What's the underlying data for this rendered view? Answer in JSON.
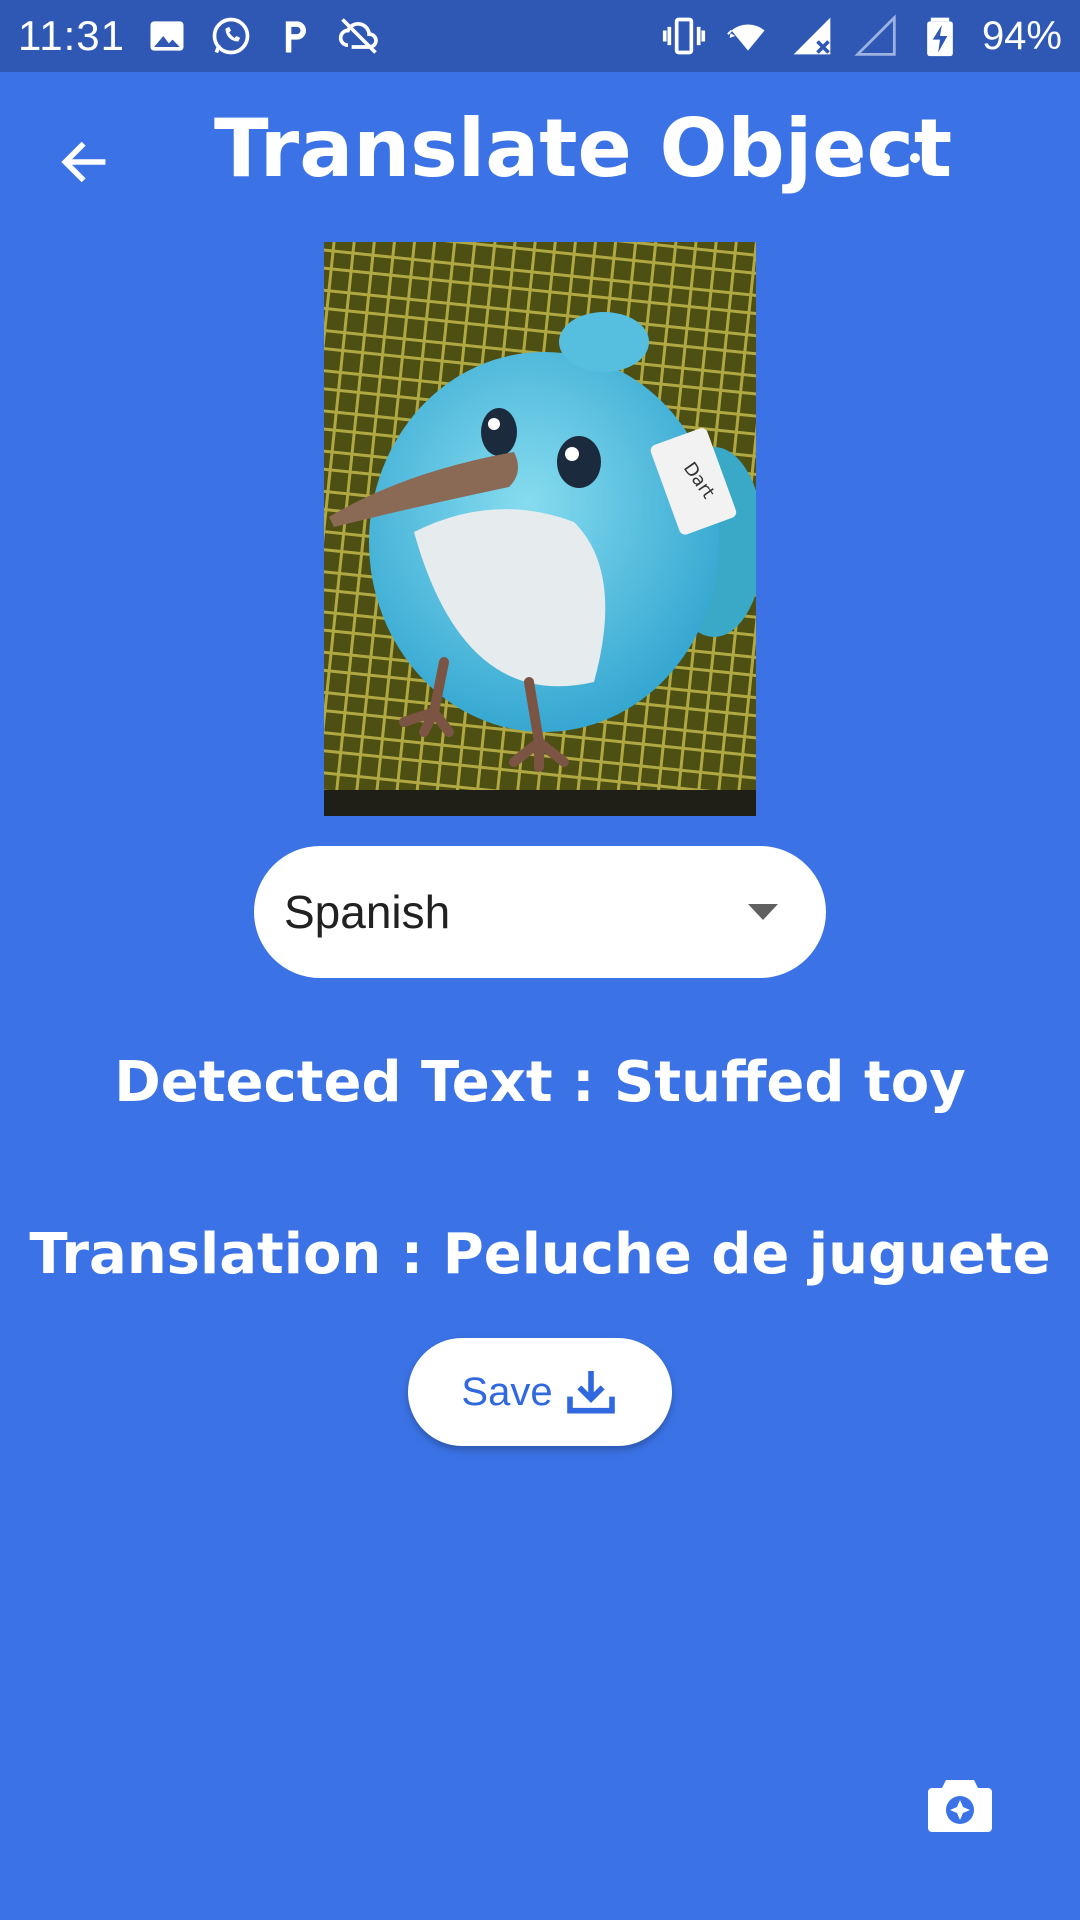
{
  "status_bar": {
    "time": "11:31",
    "battery": "94%",
    "left_icons": [
      "gallery-icon",
      "whatsapp-icon",
      "parking-icon",
      "sync-off-icon"
    ],
    "right_icons": [
      "vibrate-icon",
      "wifi-icon",
      "signal-icon",
      "signal-empty-icon",
      "battery-charging-icon"
    ]
  },
  "app_bar": {
    "title": "Translate Object",
    "back_icon": "arrow-left-icon",
    "more_icon": "more-horizontal-icon"
  },
  "photo": {
    "description_icon": "captured-photo",
    "tag_text": "Dart"
  },
  "language_select": {
    "value": "Spanish"
  },
  "results": {
    "detected": "Detected Text : Stuffed toy",
    "translation": "Translation : Peluche de juguete"
  },
  "save_button": {
    "label": "Save",
    "icon": "download-icon"
  },
  "fab": {
    "icon": "camera-icon"
  },
  "colors": {
    "background": "#3b73e7",
    "status_bar": "#2f58b5",
    "accent_text": "#2f68df",
    "white": "#ffffff"
  }
}
